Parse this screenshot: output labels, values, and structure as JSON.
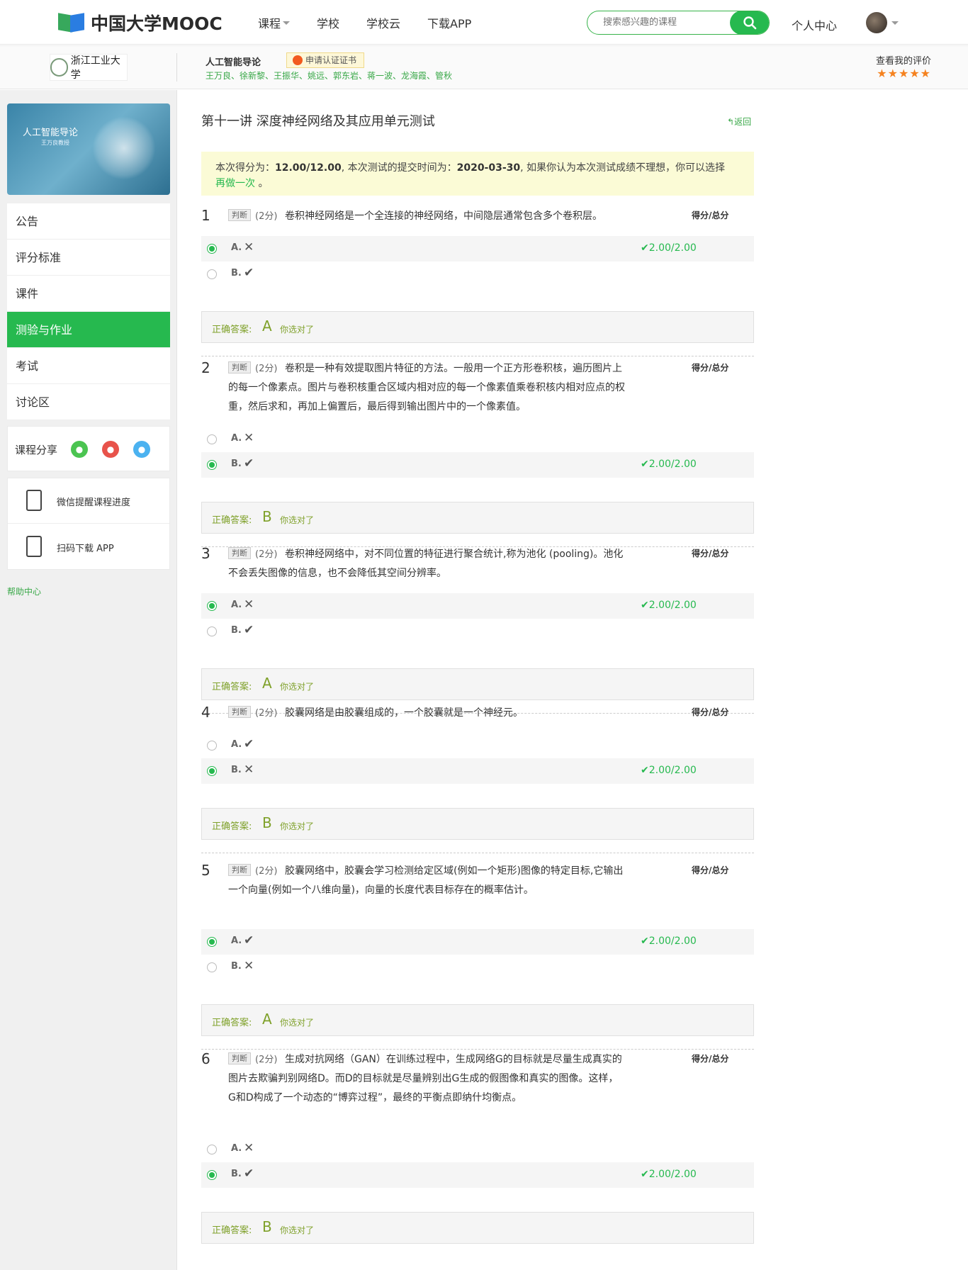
{
  "topnav": {
    "logo_text": "中国大学MOOC",
    "links": [
      "课程",
      "学校",
      "学校云",
      "下载APP"
    ],
    "search_placeholder": "搜索感兴趣的课程",
    "user_center": "个人中心"
  },
  "course": {
    "university": "浙江工业大学",
    "title": "人工智能导论",
    "cert": "申请认证证书",
    "teachers": "王万良、徐新黎、王振华、姚远、郭东岩、蒋一波、龙海霞、管秋",
    "rating_label": "查看我的评价",
    "stars": "★★★★★"
  },
  "sidebar": {
    "cover_title": "人工智能导论",
    "cover_sub": "王万良教授",
    "menu": [
      "公告",
      "评分标准",
      "课件",
      "测验与作业",
      "考试",
      "讨论区"
    ],
    "share_label": "课程分享",
    "tools": [
      "微信提醒课程进度",
      "扫码下载 APP"
    ],
    "help": "帮助中心"
  },
  "main": {
    "title": "第十一讲 深度神经网络及其应用单元测试",
    "back": "返回",
    "notice_prefix": "本次得分为：",
    "notice_score": "12.00/12.00",
    "notice_mid": ", 本次测试的提交时间为：",
    "notice_date": "2020-03-30",
    "notice_suffix": ", 如果你认为本次测试成绩不理想，你可以选择",
    "notice_redo": "再做一次",
    "notice_end": "。",
    "score_head": "得分/总分",
    "answer_label": "正确答案:",
    "answer_you": "你选对了",
    "type_label": "判断",
    "score_label": "(2分)",
    "questions": [
      {
        "num": "1",
        "text": "卷积神经网络是一个全连接的神经网络，中间隐层通常包含多个卷积层。",
        "opts": [
          {
            "l": "A.",
            "s": "✕",
            "sel": true,
            "got": "✔2.00/2.00"
          },
          {
            "l": "B.",
            "s": "✔",
            "sel": false,
            "got": ""
          }
        ],
        "answer": "A"
      },
      {
        "num": "2",
        "text": "卷积是一种有效提取图片特征的方法。一般用一个正方形卷积核，遍历图片上的每一个像素点。图片与卷积核重合区域内相对应的每一个像素值乘卷积核内相对应点的权重，然后求和，再加上偏置后，最后得到输出图片中的一个像素值。",
        "opts": [
          {
            "l": "A.",
            "s": "✕",
            "sel": false,
            "got": ""
          },
          {
            "l": "B.",
            "s": "✔",
            "sel": true,
            "got": "✔2.00/2.00"
          }
        ],
        "answer": "B"
      },
      {
        "num": "3",
        "text": "卷积神经网络中，对不同位置的特征进行聚合统计,称为池化 (pooling)。池化不会丢失图像的信息，也不会降低其空间分辨率。",
        "opts": [
          {
            "l": "A.",
            "s": "✕",
            "sel": true,
            "got": "✔2.00/2.00"
          },
          {
            "l": "B.",
            "s": "✔",
            "sel": false,
            "got": ""
          }
        ],
        "answer": "A"
      },
      {
        "num": "4",
        "text": "胶囊网络是由胶囊组成的，一个胶囊就是一个神经元。",
        "opts": [
          {
            "l": "A.",
            "s": "✔",
            "sel": false,
            "got": ""
          },
          {
            "l": "B.",
            "s": "✕",
            "sel": true,
            "got": "✔2.00/2.00"
          }
        ],
        "answer": "B"
      },
      {
        "num": "5",
        "text": "胶囊网络中，胶囊会学习检测给定区域(例如一个矩形)图像的特定目标,它输出一个向量(例如一个八维向量)，向量的长度代表目标存在的概率估计。",
        "opts": [
          {
            "l": "A.",
            "s": "✔",
            "sel": true,
            "got": "✔2.00/2.00"
          },
          {
            "l": "B.",
            "s": "✕",
            "sel": false,
            "got": ""
          }
        ],
        "answer": "A"
      },
      {
        "num": "6",
        "text": "生成对抗网络（GAN）在训练过程中，生成网络G的目标就是尽量生成真实的图片去欺骗判别网络D。而D的目标就是尽量辨别出G生成的假图像和真实的图像。这样，G和D构成了一个动态的“博弈过程”，最终的平衡点即纳什均衡点。",
        "opts": [
          {
            "l": "A.",
            "s": "✕",
            "sel": false,
            "got": ""
          },
          {
            "l": "B.",
            "s": "✔",
            "sel": true,
            "got": "✔2.00/2.00"
          }
        ],
        "answer": "B"
      }
    ]
  }
}
